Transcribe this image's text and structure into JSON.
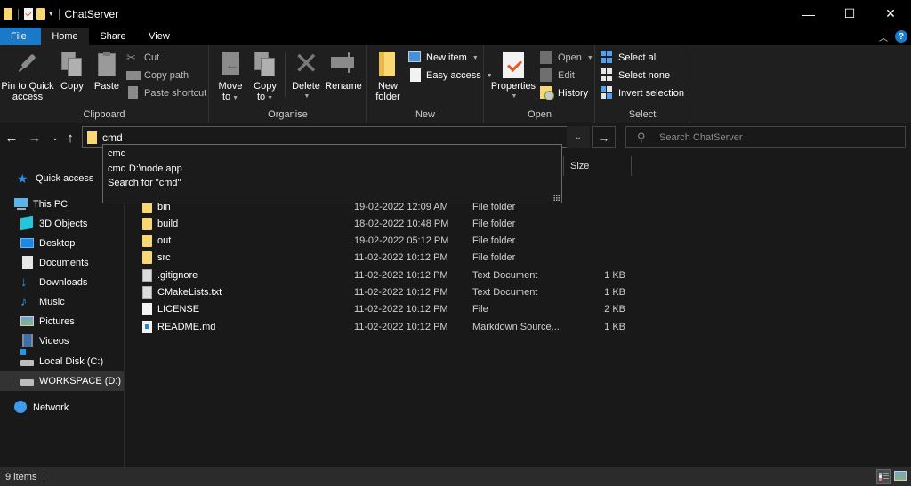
{
  "window": {
    "title": "ChatServer",
    "controls": {
      "minimize": "—",
      "maximize": "☐",
      "close": "✕"
    }
  },
  "ribbon_tabs": [
    {
      "label": "File",
      "active": false
    },
    {
      "label": "Home",
      "active": true
    },
    {
      "label": "Share",
      "active": false
    },
    {
      "label": "View",
      "active": false
    }
  ],
  "ribbon_right": {
    "collapse": "^",
    "help": "?"
  },
  "ribbon": {
    "clipboard": {
      "label": "Clipboard",
      "pin_line1": "Pin to Quick",
      "pin_line2": "access",
      "copy": "Copy",
      "paste": "Paste",
      "cut": "Cut",
      "copy_path": "Copy path",
      "paste_shortcut": "Paste shortcut"
    },
    "organise": {
      "label": "Organise",
      "move_line1": "Move",
      "move_line2": "to",
      "copy_line1": "Copy",
      "copy_line2": "to",
      "delete": "Delete",
      "rename": "Rename"
    },
    "new": {
      "label": "New",
      "new_folder_line1": "New",
      "new_folder_line2": "folder",
      "new_item": "New item",
      "easy_access": "Easy access"
    },
    "open": {
      "label": "Open",
      "properties": "Properties",
      "open": "Open",
      "edit": "Edit",
      "history": "History"
    },
    "select": {
      "label": "Select",
      "select_all": "Select all",
      "select_none": "Select none",
      "invert_selection": "Invert selection"
    }
  },
  "address_bar": {
    "value": "cmd",
    "search_placeholder": "Search ChatServer"
  },
  "autocomplete": [
    "cmd",
    "cmd D:\\node app",
    "Search for \"cmd\""
  ],
  "sidebar": {
    "items": [
      {
        "label": "Quick access",
        "icon": "star-icon"
      },
      {
        "label": "This PC",
        "icon": "computer-icon"
      },
      {
        "label": "3D Objects",
        "icon": "3d-objects-icon"
      },
      {
        "label": "Desktop",
        "icon": "desktop-icon"
      },
      {
        "label": "Documents",
        "icon": "documents-icon"
      },
      {
        "label": "Downloads",
        "icon": "downloads-icon"
      },
      {
        "label": "Music",
        "icon": "music-icon"
      },
      {
        "label": "Pictures",
        "icon": "pictures-icon"
      },
      {
        "label": "Videos",
        "icon": "videos-icon"
      },
      {
        "label": "Local Disk (C:)",
        "icon": "local-disk-icon"
      },
      {
        "label": "WORKSPACE (D:)",
        "icon": "drive-icon",
        "selected": true
      },
      {
        "label": "Network",
        "icon": "network-icon"
      }
    ]
  },
  "columns": {
    "size": "Size"
  },
  "files": [
    {
      "name": "bin",
      "date": "19-02-2022 12:09 AM",
      "type": "File folder",
      "size": "",
      "icon": "folder"
    },
    {
      "name": "build",
      "date": "18-02-2022 10:48 PM",
      "type": "File folder",
      "size": "",
      "icon": "folder"
    },
    {
      "name": "out",
      "date": "19-02-2022 05:12 PM",
      "type": "File folder",
      "size": "",
      "icon": "folder"
    },
    {
      "name": "src",
      "date": "11-02-2022 10:12 PM",
      "type": "File folder",
      "size": "",
      "icon": "folder"
    },
    {
      "name": ".gitignore",
      "date": "11-02-2022 10:12 PM",
      "type": "Text Document",
      "size": "1 KB",
      "icon": "text"
    },
    {
      "name": "CMakeLists.txt",
      "date": "11-02-2022 10:12 PM",
      "type": "Text Document",
      "size": "1 KB",
      "icon": "text"
    },
    {
      "name": "LICENSE",
      "date": "11-02-2022 10:12 PM",
      "type": "File",
      "size": "2 KB",
      "icon": "file"
    },
    {
      "name": "README.md",
      "date": "11-02-2022 10:12 PM",
      "type": "Markdown Source...",
      "size": "1 KB",
      "icon": "md"
    }
  ],
  "status": {
    "item_count": "9 items"
  },
  "colors": {
    "accent": "#1979ca",
    "folder": "#f8d775",
    "background": "#191919"
  }
}
